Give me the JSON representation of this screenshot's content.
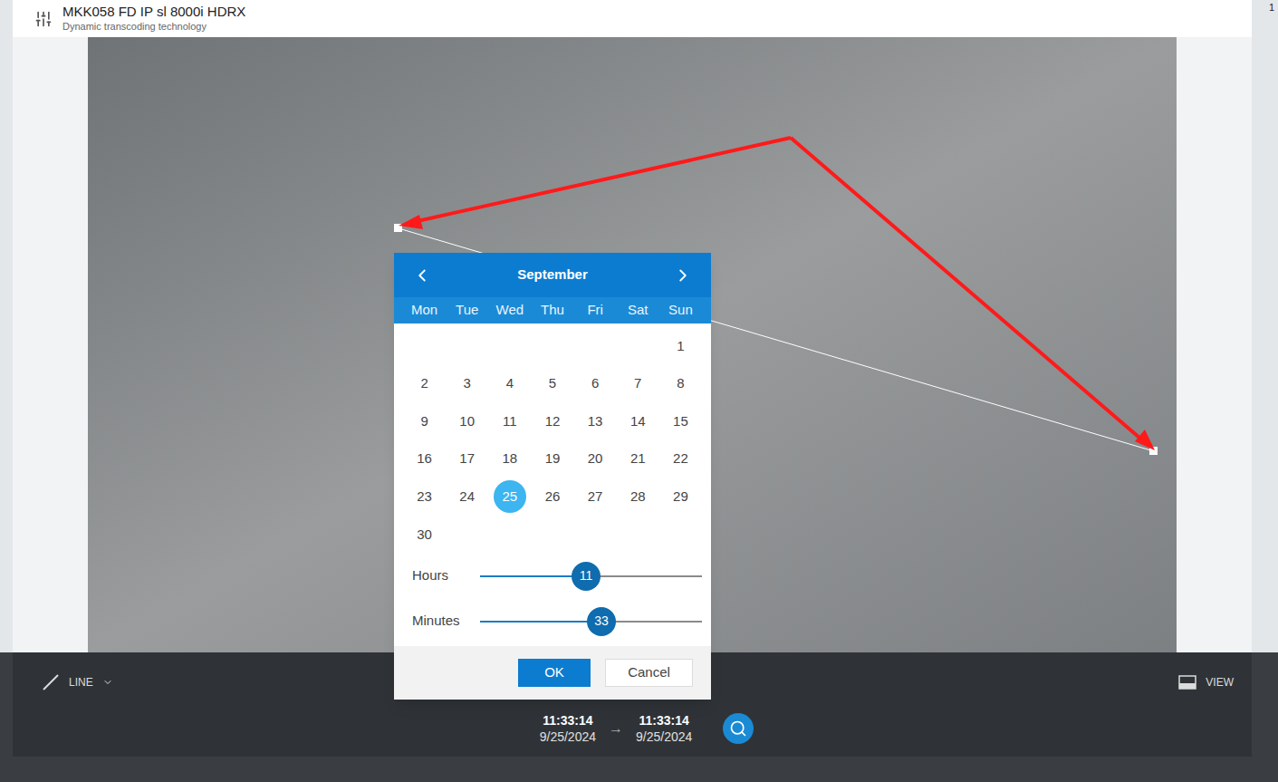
{
  "camera": {
    "title": "MKK058 FD IP sl 8000i HDRX",
    "subtitle": "Dynamic transcoding technology"
  },
  "page_marker": "1",
  "calendar": {
    "month": "September",
    "weekdays": [
      "Mon",
      "Tue",
      "Wed",
      "Thu",
      "Fri",
      "Sat",
      "Sun"
    ],
    "weeks": [
      [
        null,
        null,
        null,
        null,
        null,
        null,
        {
          "day": "1",
          "selected": false
        }
      ],
      [
        {
          "day": "2",
          "selected": false
        },
        {
          "day": "3",
          "selected": false
        },
        {
          "day": "4",
          "selected": false
        },
        {
          "day": "5",
          "selected": false
        },
        {
          "day": "6",
          "selected": false
        },
        {
          "day": "7",
          "selected": false
        },
        {
          "day": "8",
          "selected": false
        }
      ],
      [
        {
          "day": "9",
          "selected": false
        },
        {
          "day": "10",
          "selected": false
        },
        {
          "day": "11",
          "selected": false
        },
        {
          "day": "12",
          "selected": false
        },
        {
          "day": "13",
          "selected": false
        },
        {
          "day": "14",
          "selected": false
        },
        {
          "day": "15",
          "selected": false
        }
      ],
      [
        {
          "day": "16",
          "selected": false
        },
        {
          "day": "17",
          "selected": false
        },
        {
          "day": "18",
          "selected": false
        },
        {
          "day": "19",
          "selected": false
        },
        {
          "day": "20",
          "selected": false
        },
        {
          "day": "21",
          "selected": false
        },
        {
          "day": "22",
          "selected": false
        }
      ],
      [
        {
          "day": "23",
          "selected": false
        },
        {
          "day": "24",
          "selected": false
        },
        {
          "day": "25",
          "selected": true
        },
        {
          "day": "26",
          "selected": false
        },
        {
          "day": "27",
          "selected": false
        },
        {
          "day": "28",
          "selected": false
        },
        {
          "day": "29",
          "selected": false
        }
      ],
      [
        {
          "day": "30",
          "selected": false
        },
        null,
        null,
        null,
        null,
        null,
        null
      ]
    ],
    "sliders": [
      {
        "label": "Hours",
        "value": "11",
        "level": 0.478
      },
      {
        "label": "Minutes",
        "value": "33",
        "level": 0.547
      }
    ],
    "buttons": [
      {
        "label": "OK",
        "primary": true
      },
      {
        "label": "Cancel",
        "primary": false
      }
    ]
  },
  "toolbar": {
    "tool": "LINE",
    "view": "VIEW",
    "start": {
      "time": "11:33:14",
      "date": "9/25/2024"
    },
    "arrow": "→",
    "end": {
      "time": "11:33:14",
      "date": "9/25/2024"
    }
  }
}
